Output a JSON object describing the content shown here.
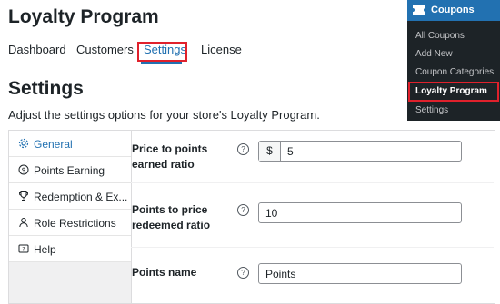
{
  "page": {
    "title": "Loyalty Program",
    "heading": "Settings",
    "description": "Adjust the settings options for your store's Loyalty Program."
  },
  "tabs": [
    {
      "label": "Dashboard"
    },
    {
      "label": "Customers"
    },
    {
      "label": "Settings",
      "active": true
    },
    {
      "label": "License"
    }
  ],
  "sidebar": {
    "items": [
      {
        "label": "General",
        "icon": "gear-icon",
        "active": true
      },
      {
        "label": "Points Earning",
        "icon": "dollar-circle-icon"
      },
      {
        "label": "Redemption & Ex...",
        "icon": "trophy-icon"
      },
      {
        "label": "Role Restrictions",
        "icon": "user-icon"
      },
      {
        "label": "Help",
        "icon": "help-icon"
      }
    ]
  },
  "settings": {
    "price_to_points": {
      "label_line1": "Price to points",
      "label_line2": "earned ratio",
      "prefix": "$",
      "value": "5"
    },
    "points_to_price": {
      "label_line1": "Points to price",
      "label_line2": "redeemed ratio",
      "value": "10"
    },
    "points_name": {
      "label": "Points name",
      "value": "Points"
    }
  },
  "help_glyph": "?",
  "admin_menu": {
    "header": "Coupons",
    "items": [
      {
        "label": "All Coupons"
      },
      {
        "label": "Add New"
      },
      {
        "label": "Coupon Categories"
      },
      {
        "label": "Loyalty Program",
        "current": true
      },
      {
        "label": "Settings"
      }
    ]
  },
  "colors": {
    "accent": "#2271b1",
    "highlight": "#e0212c",
    "admin_bg": "#1d2327"
  }
}
